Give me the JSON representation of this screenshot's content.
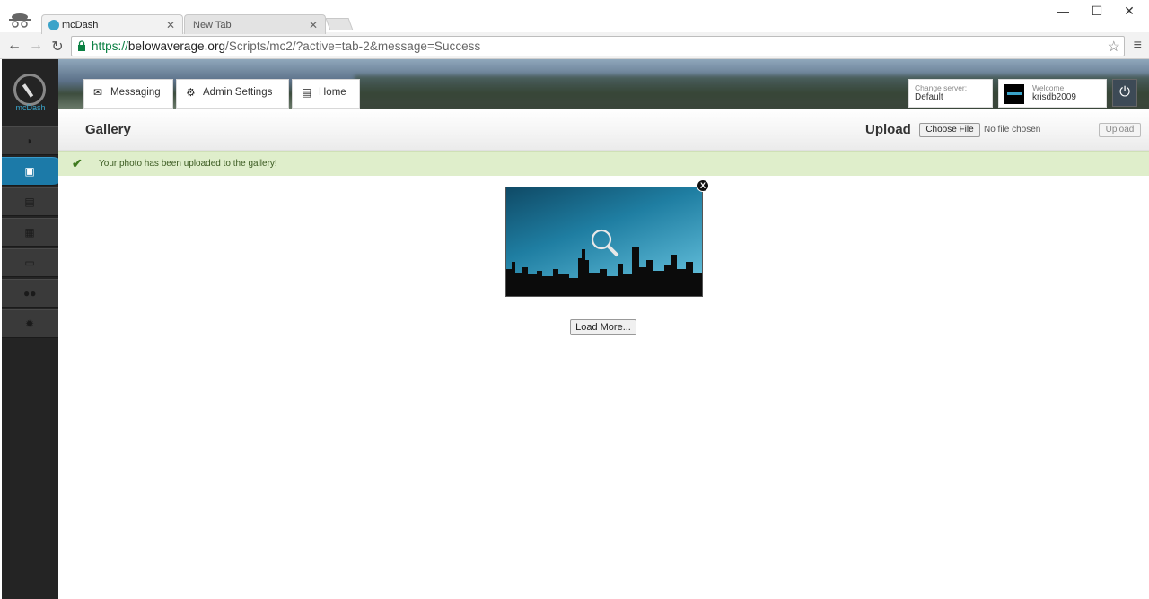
{
  "browser": {
    "tabs": [
      {
        "label": "mcDash"
      },
      {
        "label": "New Tab"
      }
    ],
    "url": {
      "scheme": "https://",
      "host": "belowaverage.org",
      "path": "/Scripts/mc2/?active=tab-2&message=Success"
    }
  },
  "app": {
    "logo_text": "mcDash",
    "top_tabs": [
      {
        "label": "Messaging",
        "icon": "envelope-icon"
      },
      {
        "label": "Admin Settings",
        "icon": "gear-icon"
      },
      {
        "label": "Home",
        "icon": "document-icon"
      }
    ],
    "server": {
      "caption": "Change server:",
      "value": "Default"
    },
    "user": {
      "caption": "Welcome",
      "name": "krisdb2009"
    },
    "sidebar": [
      {
        "icon": "dashboard-icon",
        "active": false
      },
      {
        "icon": "gallery-icon",
        "active": true
      },
      {
        "icon": "calculator-icon",
        "active": false
      },
      {
        "icon": "grid-icon",
        "active": false
      },
      {
        "icon": "chat-icon",
        "active": false
      },
      {
        "icon": "users-icon",
        "active": false
      },
      {
        "icon": "settings-icon",
        "active": false
      }
    ],
    "page_title": "Gallery",
    "upload": {
      "label": "Upload",
      "choose_file": "Choose File",
      "no_file": "No file chosen",
      "button": "Upload"
    },
    "alert": {
      "message": "Your photo has been uploaded to the gallery!"
    },
    "gallery": {
      "close_label": "X",
      "load_more": "Load More..."
    }
  }
}
